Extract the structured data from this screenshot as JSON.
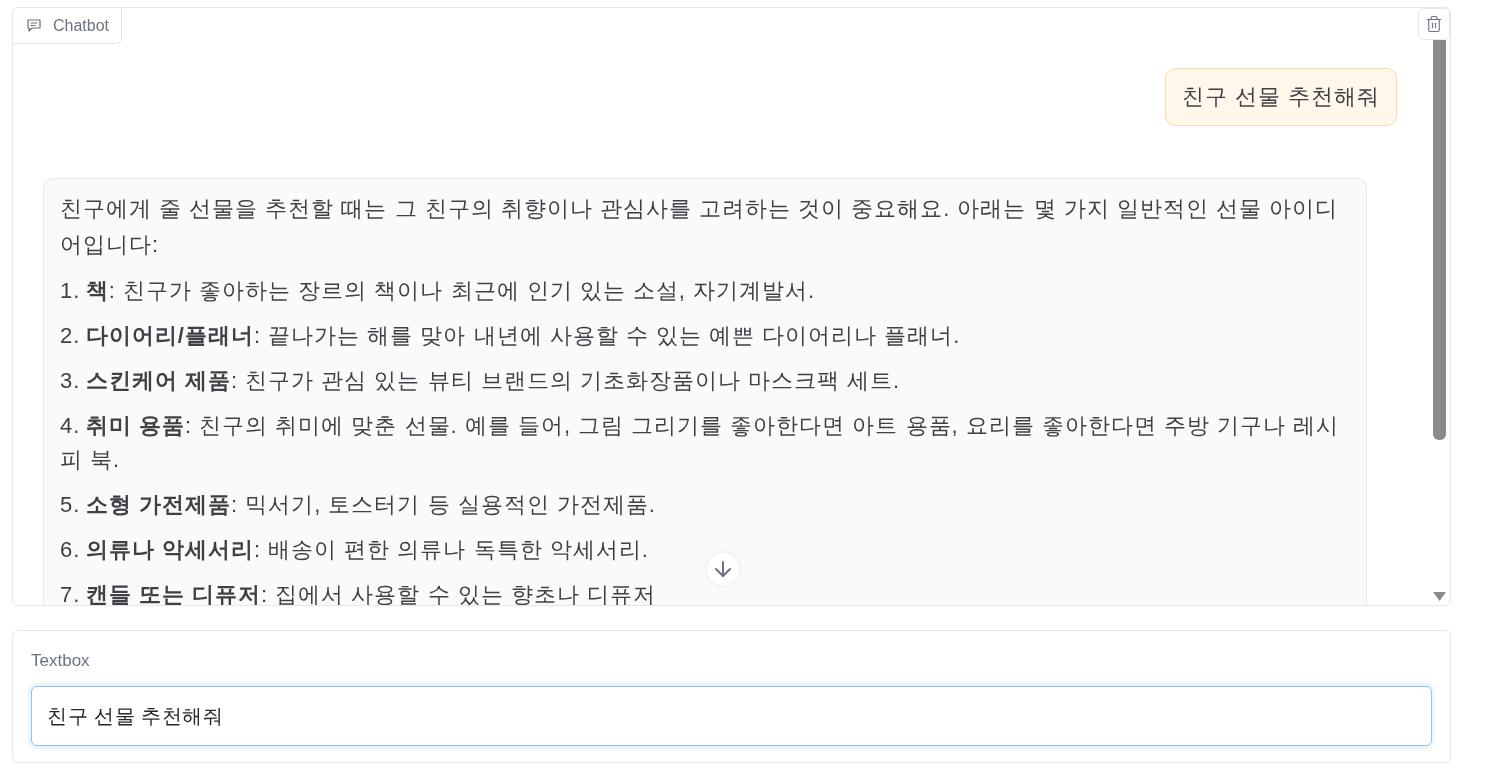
{
  "chatbot": {
    "label": "Chatbot",
    "messages": [
      {
        "kind": "user",
        "text": "친구 선물 추천해줘"
      },
      {
        "kind": "bot",
        "blocks": [
          {
            "kind": "paragraph",
            "text": "친구에게 줄 선물을 추천할 때는 그 친구의 취향이나 관심사를 고려하는 것이 중요해요. 아래는 몇 가지 일반적인 선물 아이디어입니다:"
          },
          {
            "kind": "list_item",
            "number": "1.",
            "text": "**책**: 친구가 좋아하는 장르의 책이나 최근에 인기 있는 소설, 자기계발서."
          },
          {
            "kind": "list_item",
            "number": "2.",
            "text": "**다이어리/플래너**: 끝나가는 해를 맞아 내년에 사용할 수 있는 예쁜 다이어리나 플래너."
          },
          {
            "kind": "list_item",
            "number": "3.",
            "text": "**스킨케어 제품**: 친구가 관심 있는 뷰티 브랜드의 기초화장품이나 마스크팩 세트."
          },
          {
            "kind": "list_item",
            "number": "4.",
            "text": "**취미 용품**: 친구의 취미에 맞춘 선물. 예를 들어, 그림 그리기를 좋아한다면 아트 용품, 요리를 좋아한다면 주방 기구나 레시피 북."
          },
          {
            "kind": "list_item",
            "number": "5.",
            "text": "**소형 가전제품**: 믹서기, 토스터기 등 실용적인 가전제품."
          },
          {
            "kind": "list_item",
            "number": "6.",
            "text": "**의류나 악세서리**: 배송이 편한 의류나 독특한 악세서리."
          },
          {
            "kind": "list_item",
            "number": "7.",
            "text": "**캔들 또는 디퓨저**: 집에서 사용할 수 있는 향초나 디퓨저"
          }
        ]
      }
    ]
  },
  "textbox": {
    "label": "Textbox",
    "value": "친구 선물 추천해줘",
    "focused": true
  }
}
